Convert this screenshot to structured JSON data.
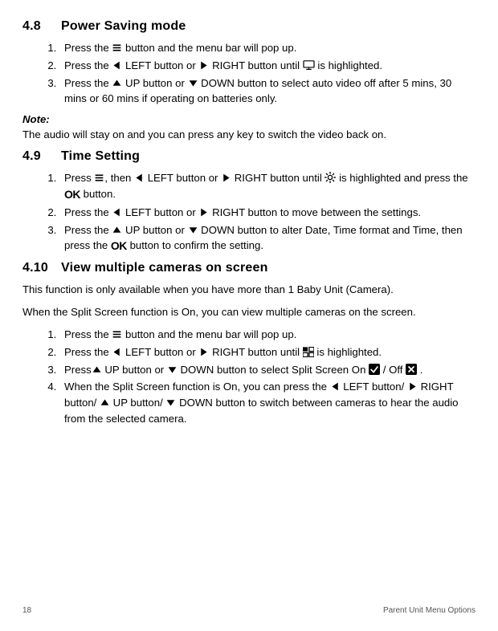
{
  "section48": {
    "num": "4.8",
    "title": "Power Saving mode",
    "steps": [
      [
        {
          "t": "Press the "
        },
        {
          "icon": "menu"
        },
        {
          "t": " button and the menu bar will pop up."
        }
      ],
      [
        {
          "t": "Press the "
        },
        {
          "icon": "left"
        },
        {
          "t": " LEFT button or "
        },
        {
          "icon": "right"
        },
        {
          "t": " RIGHT button until "
        },
        {
          "icon": "monitor"
        },
        {
          "t": " is highlighted."
        }
      ],
      [
        {
          "t": "Press the "
        },
        {
          "icon": "up"
        },
        {
          "t": " UP button or "
        },
        {
          "icon": "down"
        },
        {
          "t": " DOWN button to select auto video off after 5 mins, 30 mins or 60 mins if operating on batteries only."
        }
      ]
    ],
    "note_label": "Note:",
    "note_text": "The audio will stay on and you can press any key to switch the video back on."
  },
  "section49": {
    "num": "4.9",
    "title": "Time Setting",
    "steps": [
      [
        {
          "t": "Press "
        },
        {
          "icon": "menu"
        },
        {
          "t": ", then "
        },
        {
          "icon": "left"
        },
        {
          "t": " LEFT button or "
        },
        {
          "icon": "right"
        },
        {
          "t": " RIGHT button until "
        },
        {
          "icon": "gear"
        },
        {
          "t": " is highlighted and press the "
        },
        {
          "icon": "ok"
        },
        {
          "t": "  button."
        }
      ],
      [
        {
          "t": "Press the "
        },
        {
          "icon": "left"
        },
        {
          "t": " LEFT button or "
        },
        {
          "icon": "right"
        },
        {
          "t": " RIGHT button to move between the settings."
        }
      ],
      [
        {
          "t": "Press the "
        },
        {
          "icon": "up"
        },
        {
          "t": " UP button or "
        },
        {
          "icon": "down"
        },
        {
          "t": " DOWN button to alter Date, Time format and Time, then press the "
        },
        {
          "icon": "ok"
        },
        {
          "t": " button to confirm the setting."
        }
      ]
    ]
  },
  "section410": {
    "num": "4.10",
    "title": "View multiple cameras on screen",
    "intro1": "This function is only available when you have more than 1 Baby Unit (Camera).",
    "intro2": "When the Split Screen function is On, you can view multiple cameras on the screen.",
    "steps": [
      [
        {
          "t": "Press the "
        },
        {
          "icon": "menu"
        },
        {
          "t": " button and the menu bar will pop up."
        }
      ],
      [
        {
          "t": "Press the "
        },
        {
          "icon": "left"
        },
        {
          "t": " LEFT button or "
        },
        {
          "icon": "right"
        },
        {
          "t": " RIGHT button until "
        },
        {
          "icon": "split"
        },
        {
          "t": " is highlighted."
        }
      ],
      [
        {
          "t": "Press"
        },
        {
          "icon": "up"
        },
        {
          "t": " UP button or "
        },
        {
          "icon": "down"
        },
        {
          "t": " DOWN button to select Split Screen On "
        },
        {
          "icon": "check"
        },
        {
          "t": "  / Off "
        },
        {
          "icon": "x"
        },
        {
          "t": " ."
        }
      ],
      [
        {
          "t": "When the Split Screen function is On, you can press the "
        },
        {
          "icon": "left"
        },
        {
          "t": " LEFT button/ "
        },
        {
          "icon": "right"
        },
        {
          "t": " RIGHT button/ "
        },
        {
          "icon": "up"
        },
        {
          "t": " UP button/ "
        },
        {
          "icon": "down"
        },
        {
          "t": " DOWN button to switch between cameras to hear the audio from the selected camera."
        }
      ]
    ]
  },
  "footer": {
    "page": "18",
    "title": "Parent Unit Menu Options"
  }
}
